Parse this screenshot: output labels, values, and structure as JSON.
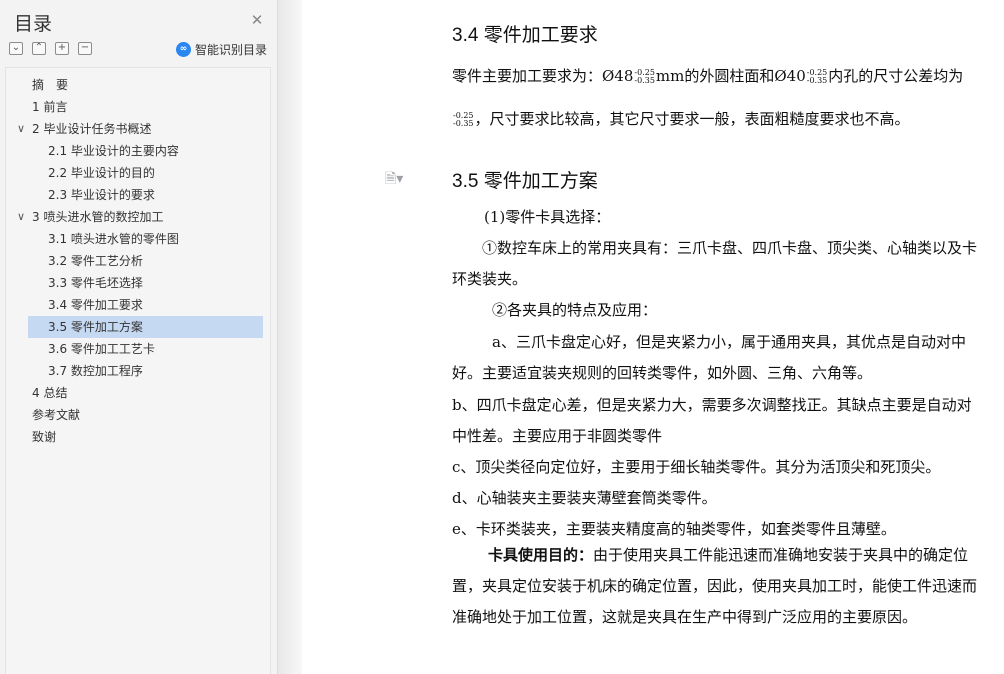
{
  "toc": {
    "title": "目录",
    "close_icon": "close-icon",
    "tools": [
      {
        "name": "collapse-all-icon",
        "glyph": "⌄"
      },
      {
        "name": "expand-all-icon",
        "glyph": "⌃"
      },
      {
        "name": "add-level-icon",
        "glyph": "+"
      },
      {
        "name": "remove-level-icon",
        "glyph": "−"
      }
    ],
    "smart_toc_label": "智能识别目录",
    "items": [
      {
        "label": "摘　要",
        "level": 1,
        "chevron": ""
      },
      {
        "label": "1 前言",
        "level": 1,
        "chevron": ""
      },
      {
        "label": "2  毕业设计任务书概述",
        "level": 1,
        "chevron": "∨"
      },
      {
        "label": "2.1    毕业设计的主要内容",
        "level": 2,
        "chevron": ""
      },
      {
        "label": "2.2    毕业设计的目的",
        "level": 2,
        "chevron": ""
      },
      {
        "label": "2.3    毕业设计的要求",
        "level": 2,
        "chevron": ""
      },
      {
        "label": "3  喷头进水管的数控加工",
        "level": 1,
        "chevron": "∨"
      },
      {
        "label": "3.1    喷头进水管的零件图",
        "level": 2,
        "chevron": ""
      },
      {
        "label": "3.2    零件工艺分析",
        "level": 2,
        "chevron": ""
      },
      {
        "label": "3.3    零件毛坯选择",
        "level": 2,
        "chevron": ""
      },
      {
        "label": "3.4    零件加工要求",
        "level": 2,
        "chevron": ""
      },
      {
        "label": "3.5    零件加工方案",
        "level": 2,
        "chevron": "",
        "selected": true
      },
      {
        "label": "3.6    零件加工工艺卡",
        "level": 2,
        "chevron": ""
      },
      {
        "label": "3.7    数控加工程序",
        "level": 2,
        "chevron": ""
      },
      {
        "label": "4 总结",
        "level": 1,
        "chevron": ""
      },
      {
        "label": "参考文献",
        "level": 1,
        "chevron": ""
      },
      {
        "label": "致谢",
        "level": 1,
        "chevron": ""
      }
    ]
  },
  "document": {
    "heading_34": "3.4    零件加工要求",
    "req_line1_a": "零件主要加工要求为：Ø48",
    "tol_upper": "-0.25",
    "tol_lower": "-0.35",
    "req_line1_b": "mm的外圆柱面和Ø40",
    "req_line1_c": "内孔的尺寸公差均为",
    "req_line2": "，尺寸要求比较高，其它尺寸要求一般，表面粗糙度要求也不高。",
    "heading_35": "3.5    零件加工方案",
    "p1": "(1)零件卡具选择：",
    "p2": "①数控车床上的常用夹具有：三爪卡盘、四爪卡盘、顶尖类、心轴类以及卡环类装夹。",
    "p3": "②各夹具的特点及应用：",
    "p4": "a、三爪卡盘定心好，但是夹紧力小，属于通用夹具，其优点是自动对中好。主要适宜装夹规则的回转类零件，如外圆、三角、六角等。",
    "p5": "b、四爪卡盘定心差，但是夹紧力大，需要多次调整找正。其缺点主要是自动对中性差。主要应用于非圆类零件",
    "p6": "c、顶尖类径向定位好，主要用于细长轴类零件。其分为活顶尖和死顶尖。",
    "p7": "d、心轴装夹主要装夹薄壁套筒类零件。",
    "p8": "e、卡环类装夹，主要装夹精度高的轴类零件，如套类零件且薄壁。",
    "p9_bold": "卡具使用目的：",
    "p9": "由于使用夹具工件能迅速而准确地安装于夹具中的确定位置，夹具定位安装于机床的确定位置，因此，使用夹具加工时，能使工件迅速而准确地处于加工位置，这就是夹具在生产中得到广泛应用的主要原因。"
  }
}
